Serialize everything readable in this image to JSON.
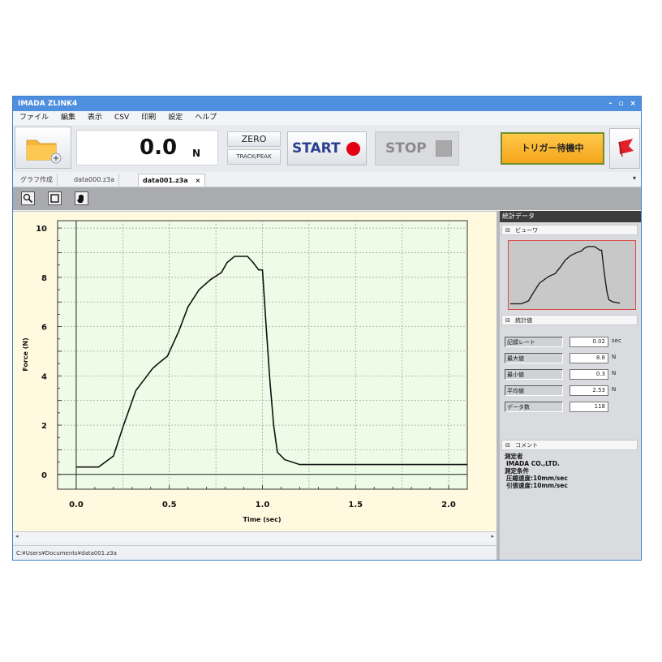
{
  "window": {
    "title": "IMADA ZLINK4",
    "controls": [
      "-",
      "▫",
      "×"
    ]
  },
  "menu": [
    "ファイル",
    "編集",
    "表示",
    "CSV",
    "印刷",
    "設定",
    "ヘルプ"
  ],
  "toolbar": {
    "readout_value": "0.0",
    "readout_unit": "N",
    "zero_label": "ZERO",
    "track_label": "TRACK/PEAK",
    "start_label": "START",
    "stop_label": "STOP",
    "trigger_label": "トリガー待機中",
    "colors": {
      "start_dot": "#e40010",
      "trigger": "#f5a51b",
      "flag": "#e0202a"
    }
  },
  "tabs": [
    {
      "label": "グラフ作成"
    },
    {
      "label": "data000.z3a"
    },
    {
      "label": "data001.z3a",
      "close": "×",
      "active": true
    }
  ],
  "graph_tools": [
    "zoom-icon",
    "fit-icon",
    "hand-icon"
  ],
  "chart_data": {
    "type": "line",
    "xlabel": "Time (sec)",
    "ylabel": "Force (N)",
    "xlim": [
      -0.1,
      2.1
    ],
    "ylim": [
      -0.6,
      10.3
    ],
    "x_ticks": [
      "0.0",
      "0.5",
      "1.0",
      "1.5",
      "2.0"
    ],
    "y_ticks": [
      "0",
      "2",
      "4",
      "6",
      "8",
      "10"
    ],
    "grid": true,
    "series": [
      {
        "x": [
          0,
          0.12,
          0.2,
          0.25,
          0.32,
          0.38,
          0.41,
          0.44,
          0.49,
          0.52,
          0.55,
          0.6,
          0.66,
          0.72,
          0.78,
          0.81,
          0.85,
          0.9,
          0.92,
          0.95,
          0.98,
          1.0,
          1.02,
          1.04,
          1.06,
          1.08,
          1.12,
          1.2,
          1.5,
          2.1
        ],
        "y": [
          0.3,
          0.3,
          0.75,
          1.9,
          3.4,
          4.0,
          4.3,
          4.5,
          4.8,
          5.3,
          5.8,
          6.8,
          7.5,
          7.9,
          8.2,
          8.6,
          8.85,
          8.85,
          8.85,
          8.6,
          8.3,
          8.3,
          6.0,
          3.8,
          2.0,
          0.9,
          0.6,
          0.4,
          0.4,
          0.4
        ]
      }
    ]
  },
  "status_path": "C:¥Users¥Documents¥data001.z3a",
  "panel": {
    "header": "統計データ",
    "preview_label": "ビューワ",
    "stats_label": "統計値",
    "stats": [
      {
        "label": "記録レート",
        "value": "0.02",
        "unit": "sec"
      },
      {
        "label": "最大値",
        "value": "8.8",
        "unit": "N"
      },
      {
        "label": "最小値",
        "value": "0.3",
        "unit": "N"
      },
      {
        "label": "平均値",
        "value": "2.53",
        "unit": "N"
      },
      {
        "label": "データ数",
        "value": "118",
        "unit": ""
      }
    ],
    "comment_label": "コメント",
    "comment_lines": [
      "測定者",
      "IMADA CO.,LTD.",
      "測定条件",
      "圧縮速度:10mm/sec",
      "引張速度:10mm/sec"
    ]
  }
}
